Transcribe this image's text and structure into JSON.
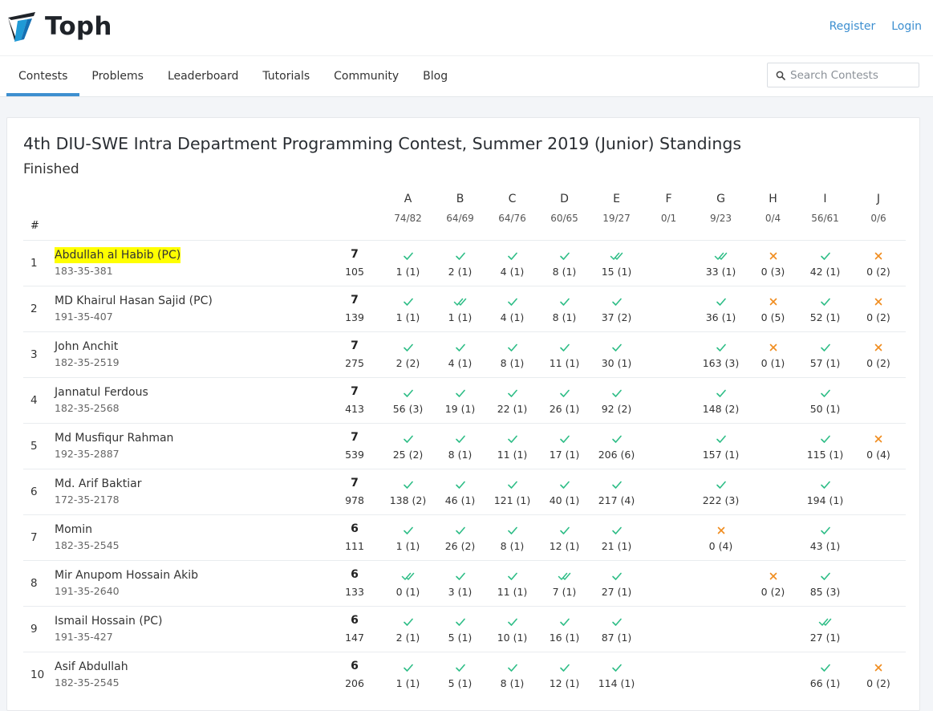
{
  "brand": {
    "name": "Toph"
  },
  "auth": {
    "register": "Register",
    "login": "Login"
  },
  "nav": {
    "items": [
      "Contests",
      "Problems",
      "Leaderboard",
      "Tutorials",
      "Community",
      "Blog"
    ],
    "active": 0
  },
  "search": {
    "placeholder": "Search Contests",
    "value": ""
  },
  "colors": {
    "accent": "#3d8fd0",
    "accepted": "#2dbd86",
    "rejected": "#f08c1e",
    "highlight": "#ffff00"
  },
  "standings": {
    "title": "4th DIU-SWE Intra Department Programming Contest, Summer 2019 (Junior) Standings",
    "status": "Finished",
    "rank_header": "#",
    "problems": [
      {
        "letter": "A",
        "ratio": "74/82"
      },
      {
        "letter": "B",
        "ratio": "64/69"
      },
      {
        "letter": "C",
        "ratio": "64/76"
      },
      {
        "letter": "D",
        "ratio": "60/65"
      },
      {
        "letter": "E",
        "ratio": "19/27"
      },
      {
        "letter": "F",
        "ratio": "0/1"
      },
      {
        "letter": "G",
        "ratio": "9/23"
      },
      {
        "letter": "H",
        "ratio": "0/4"
      },
      {
        "letter": "I",
        "ratio": "56/61"
      },
      {
        "letter": "J",
        "ratio": "0/6"
      }
    ],
    "rows": [
      {
        "rank": "1",
        "name": "Abdullah al Habib (PC)",
        "id": "183-35-381",
        "highlight": true,
        "solved": "7",
        "penalty": "105",
        "cells": [
          [
            "ok",
            "1 (1)"
          ],
          [
            "ok",
            "2 (1)"
          ],
          [
            "ok",
            "4 (1)"
          ],
          [
            "ok",
            "8 (1)"
          ],
          [
            "first",
            "15 (1)"
          ],
          null,
          [
            "first",
            "33 (1)"
          ],
          [
            "x",
            "0 (3)"
          ],
          [
            "ok",
            "42 (1)"
          ],
          [
            "x",
            "0 (2)"
          ]
        ]
      },
      {
        "rank": "2",
        "name": "MD Khairul Hasan Sajid (PC)",
        "id": "191-35-407",
        "solved": "7",
        "penalty": "139",
        "cells": [
          [
            "ok",
            "1 (1)"
          ],
          [
            "first",
            "1 (1)"
          ],
          [
            "ok",
            "4 (1)"
          ],
          [
            "ok",
            "8 (1)"
          ],
          [
            "ok",
            "37 (2)"
          ],
          null,
          [
            "ok",
            "36 (1)"
          ],
          [
            "x",
            "0 (5)"
          ],
          [
            "ok",
            "52 (1)"
          ],
          [
            "x",
            "0 (2)"
          ]
        ]
      },
      {
        "rank": "3",
        "name": "John Anchit",
        "id": "182-35-2519",
        "solved": "7",
        "penalty": "275",
        "cells": [
          [
            "ok",
            "2 (2)"
          ],
          [
            "ok",
            "4 (1)"
          ],
          [
            "ok",
            "8 (1)"
          ],
          [
            "ok",
            "11 (1)"
          ],
          [
            "ok",
            "30 (1)"
          ],
          null,
          [
            "ok",
            "163 (3)"
          ],
          [
            "x",
            "0 (1)"
          ],
          [
            "ok",
            "57 (1)"
          ],
          [
            "x",
            "0 (2)"
          ]
        ]
      },
      {
        "rank": "4",
        "name": "Jannatul Ferdous",
        "id": "182-35-2568",
        "solved": "7",
        "penalty": "413",
        "cells": [
          [
            "ok",
            "56 (3)"
          ],
          [
            "ok",
            "19 (1)"
          ],
          [
            "ok",
            "22 (1)"
          ],
          [
            "ok",
            "26 (1)"
          ],
          [
            "ok",
            "92 (2)"
          ],
          null,
          [
            "ok",
            "148 (2)"
          ],
          null,
          [
            "ok",
            "50 (1)"
          ],
          null
        ]
      },
      {
        "rank": "5",
        "name": "Md Musfiqur Rahman",
        "id": "192-35-2887",
        "solved": "7",
        "penalty": "539",
        "cells": [
          [
            "ok",
            "25 (2)"
          ],
          [
            "ok",
            "8 (1)"
          ],
          [
            "ok",
            "11 (1)"
          ],
          [
            "ok",
            "17 (1)"
          ],
          [
            "ok",
            "206 (6)"
          ],
          null,
          [
            "ok",
            "157 (1)"
          ],
          null,
          [
            "ok",
            "115 (1)"
          ],
          [
            "x",
            "0 (4)"
          ]
        ]
      },
      {
        "rank": "6",
        "name": "Md. Arif Baktiar",
        "id": "172-35-2178",
        "solved": "7",
        "penalty": "978",
        "cells": [
          [
            "ok",
            "138 (2)"
          ],
          [
            "ok",
            "46 (1)"
          ],
          [
            "ok",
            "121 (1)"
          ],
          [
            "ok",
            "40 (1)"
          ],
          [
            "ok",
            "217 (4)"
          ],
          null,
          [
            "ok",
            "222 (3)"
          ],
          null,
          [
            "ok",
            "194 (1)"
          ],
          null
        ]
      },
      {
        "rank": "7",
        "name": "Momin",
        "id": "182-35-2545",
        "solved": "6",
        "penalty": "111",
        "cells": [
          [
            "ok",
            "1 (1)"
          ],
          [
            "ok",
            "26 (2)"
          ],
          [
            "ok",
            "8 (1)"
          ],
          [
            "ok",
            "12 (1)"
          ],
          [
            "ok",
            "21 (1)"
          ],
          null,
          [
            "x",
            "0 (4)"
          ],
          null,
          [
            "ok",
            "43 (1)"
          ],
          null
        ]
      },
      {
        "rank": "8",
        "name": "Mir Anupom Hossain Akib",
        "id": "191-35-2640",
        "solved": "6",
        "penalty": "133",
        "cells": [
          [
            "first",
            "0 (1)"
          ],
          [
            "ok",
            "3 (1)"
          ],
          [
            "ok",
            "11 (1)"
          ],
          [
            "first",
            "7 (1)"
          ],
          [
            "ok",
            "27 (1)"
          ],
          null,
          null,
          [
            "x",
            "0 (2)"
          ],
          [
            "ok",
            "85 (3)"
          ],
          null
        ]
      },
      {
        "rank": "9",
        "name": "Ismail Hossain (PC)",
        "id": "191-35-427",
        "solved": "6",
        "penalty": "147",
        "cells": [
          [
            "ok",
            "2 (1)"
          ],
          [
            "ok",
            "5 (1)"
          ],
          [
            "ok",
            "10 (1)"
          ],
          [
            "ok",
            "16 (1)"
          ],
          [
            "ok",
            "87 (1)"
          ],
          null,
          null,
          null,
          [
            "first",
            "27 (1)"
          ],
          null
        ]
      },
      {
        "rank": "10",
        "name": "Asif Abdullah",
        "id": "182-35-2545",
        "solved": "6",
        "penalty": "206",
        "cells": [
          [
            "ok",
            "1 (1)"
          ],
          [
            "ok",
            "5 (1)"
          ],
          [
            "ok",
            "8 (1)"
          ],
          [
            "ok",
            "12 (1)"
          ],
          [
            "ok",
            "114 (1)"
          ],
          null,
          null,
          null,
          [
            "ok",
            "66 (1)"
          ],
          [
            "x",
            "0 (2)"
          ]
        ]
      }
    ]
  }
}
